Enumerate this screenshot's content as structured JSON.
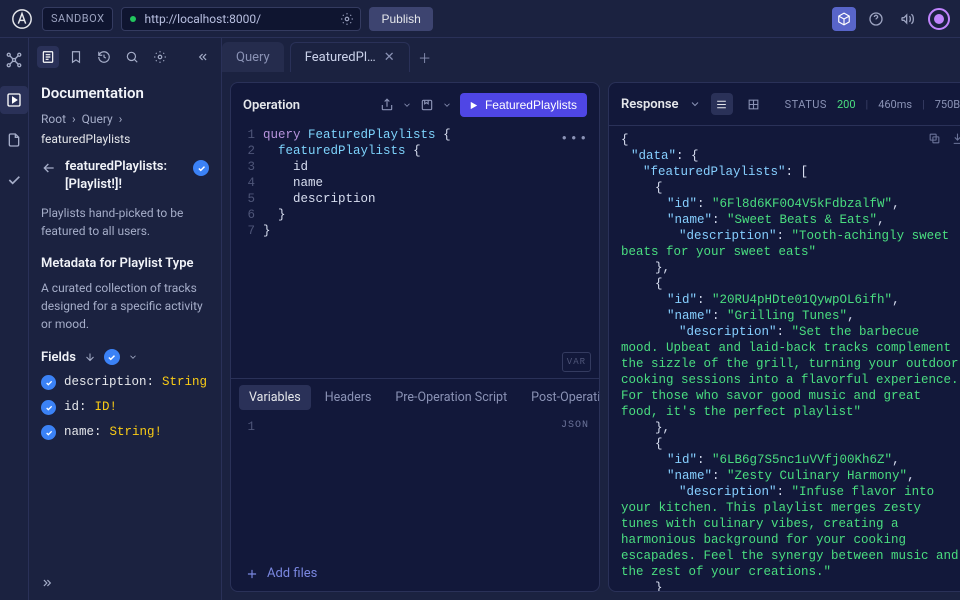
{
  "topbar": {
    "env_label": "SANDBOX",
    "url": "http://localhost:8000/",
    "publish_label": "Publish"
  },
  "doc": {
    "title": "Documentation",
    "crumbs": [
      "Root",
      "Query",
      "featuredPlaylists"
    ],
    "signature": "featuredPlaylists: [Playlist!]!",
    "description": "Playlists hand-picked to be featured to all users.",
    "meta_heading": "Metadata for Playlist Type",
    "meta_desc": "A curated collection of tracks designed for a specific activity or mood.",
    "fields_heading": "Fields",
    "fields": [
      {
        "name": "description:",
        "type": "String"
      },
      {
        "name": "id:",
        "type": "ID!"
      },
      {
        "name": "name:",
        "type": "String!"
      }
    ]
  },
  "tabs": {
    "inactive": "Query",
    "active": "FeaturedPlay…"
  },
  "operation": {
    "title": "Operation",
    "run_label": "FeaturedPlaylists",
    "code_lines": [
      {
        "n": "1",
        "html": "<span class='kw'>query</span> <span class='ident'>FeaturedPlaylists</span> <span class='brace'>{</span>"
      },
      {
        "n": "2",
        "html": "  <span class='ident'>featuredPlaylists</span> <span class='brace'>{</span>"
      },
      {
        "n": "3",
        "html": "    id"
      },
      {
        "n": "4",
        "html": "    name"
      },
      {
        "n": "5",
        "html": "    description"
      },
      {
        "n": "6",
        "html": "  <span class='brace'>}</span>"
      },
      {
        "n": "7",
        "html": "<span class='brace'>}</span>"
      }
    ],
    "var_badge": "VAR",
    "lower_tabs": [
      "Variables",
      "Headers",
      "Pre-Operation Script",
      "Post-Operation Script"
    ],
    "json_badge": "JSON",
    "add_files": "Add files"
  },
  "response": {
    "title": "Response",
    "status_label": "STATUS",
    "status_code": "200",
    "time": "460ms",
    "size": "750B",
    "json": {
      "data": {
        "featuredPlaylists": [
          {
            "id": "6Fl8d6KF0O4V5kFdbzalfW",
            "name": "Sweet Beats & Eats",
            "description": "Tooth-achingly sweet beats for your sweet eats"
          },
          {
            "id": "20RU4pHDte01QywpOL6ifh",
            "name": "Grilling Tunes",
            "description": "Set the barbecue mood. Upbeat and laid-back tracks complement the sizzle of the grill, turning your outdoor cooking sessions into a flavorful experience. For those who savor good music and great food, it&#x27;s the perfect playlist"
          },
          {
            "id": "6LB6g7S5nc1uVVfj00Kh6Z",
            "name": "Zesty Culinary Harmony",
            "description": "Infuse flavor into your kitchen. This playlist merges zesty tunes with culinary vibes, creating a harmonious background for your cooking escapades. Feel the synergy between music and the zest of your creations."
          }
        ]
      }
    }
  }
}
